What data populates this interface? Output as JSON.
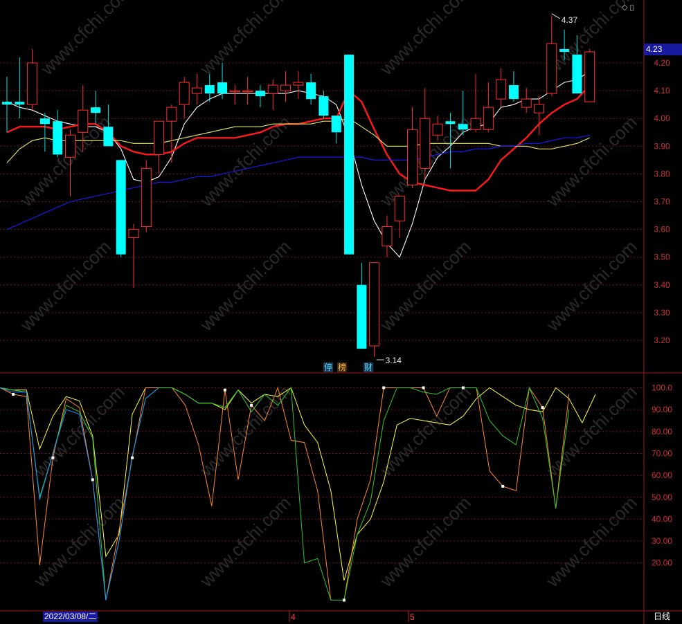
{
  "chart_data": [
    {
      "type": "candlestick",
      "title": "",
      "y_axis_labels": [
        "4.20",
        "4.10",
        "4.00",
        "3.90",
        "3.80",
        "3.70",
        "3.60",
        "3.50",
        "3.40",
        "3.30",
        "3.20"
      ],
      "ylim": [
        3.12,
        4.4
      ],
      "current_price": "4.23",
      "high_marker": "4.37",
      "low_marker": "3.14",
      "candles": [
        {
          "o": 4.06,
          "h": 4.15,
          "l": 3.95,
          "c": 4.05
        },
        {
          "o": 4.06,
          "h": 4.22,
          "l": 4.0,
          "c": 4.05
        },
        {
          "o": 4.05,
          "h": 4.25,
          "l": 4.03,
          "c": 4.2
        },
        {
          "o": 4.0,
          "h": 4.02,
          "l": 3.88,
          "c": 3.98
        },
        {
          "o": 3.99,
          "h": 4.03,
          "l": 3.86,
          "c": 3.87
        },
        {
          "o": 3.86,
          "h": 3.96,
          "l": 3.72,
          "c": 3.94
        },
        {
          "o": 3.95,
          "h": 4.12,
          "l": 3.88,
          "c": 4.03
        },
        {
          "o": 4.04,
          "h": 4.1,
          "l": 3.98,
          "c": 4.02
        },
        {
          "o": 3.97,
          "h": 4.05,
          "l": 3.9,
          "c": 3.9
        },
        {
          "o": 3.85,
          "h": 3.85,
          "l": 3.5,
          "c": 3.51
        },
        {
          "o": 3.57,
          "h": 3.62,
          "l": 3.39,
          "c": 3.6
        },
        {
          "o": 3.61,
          "h": 3.85,
          "l": 3.59,
          "c": 3.82
        },
        {
          "o": 3.87,
          "h": 3.99,
          "l": 3.8,
          "c": 3.99
        },
        {
          "o": 3.99,
          "h": 4.05,
          "l": 3.84,
          "c": 4.04
        },
        {
          "o": 4.05,
          "h": 4.15,
          "l": 4.0,
          "c": 4.13
        },
        {
          "o": 4.09,
          "h": 4.16,
          "l": 4.05,
          "c": 4.11
        },
        {
          "o": 4.12,
          "h": 4.16,
          "l": 4.06,
          "c": 4.09
        },
        {
          "o": 4.13,
          "h": 4.2,
          "l": 4.07,
          "c": 4.09
        },
        {
          "o": 4.1,
          "h": 4.12,
          "l": 4.05,
          "c": 4.1
        },
        {
          "o": 4.1,
          "h": 4.15,
          "l": 4.05,
          "c": 4.1
        },
        {
          "o": 4.1,
          "h": 4.12,
          "l": 4.04,
          "c": 4.08
        },
        {
          "o": 4.09,
          "h": 4.14,
          "l": 4.03,
          "c": 4.12
        },
        {
          "o": 4.1,
          "h": 4.17,
          "l": 4.06,
          "c": 4.12
        },
        {
          "o": 4.12,
          "h": 4.17,
          "l": 4.07,
          "c": 4.13
        },
        {
          "o": 4.13,
          "h": 4.16,
          "l": 4.05,
          "c": 4.07
        },
        {
          "o": 4.08,
          "h": 4.1,
          "l": 4.0,
          "c": 4.01
        },
        {
          "o": 4.01,
          "h": 4.0,
          "l": 3.91,
          "c": 3.95
        },
        {
          "o": 4.23,
          "h": 4.23,
          "l": 3.51,
          "c": 3.51
        },
        {
          "o": 3.4,
          "h": 3.48,
          "l": 3.17,
          "c": 3.17
        },
        {
          "o": 3.18,
          "h": 3.48,
          "l": 3.14,
          "c": 3.48
        },
        {
          "o": 3.54,
          "h": 3.65,
          "l": 3.5,
          "c": 3.61
        },
        {
          "o": 3.63,
          "h": 3.72,
          "l": 3.57,
          "c": 3.72
        },
        {
          "o": 3.76,
          "h": 4.04,
          "l": 3.75,
          "c": 3.96
        },
        {
          "o": 3.82,
          "h": 4.11,
          "l": 3.78,
          "c": 4.0
        },
        {
          "o": 3.94,
          "h": 4.01,
          "l": 3.92,
          "c": 3.98
        },
        {
          "o": 3.99,
          "h": 4.02,
          "l": 3.82,
          "c": 3.98
        },
        {
          "o": 3.98,
          "h": 4.1,
          "l": 3.94,
          "c": 3.96
        },
        {
          "o": 3.96,
          "h": 4.16,
          "l": 3.95,
          "c": 4.0
        },
        {
          "o": 3.96,
          "h": 4.13,
          "l": 3.95,
          "c": 4.04
        },
        {
          "o": 4.07,
          "h": 4.18,
          "l": 4.04,
          "c": 4.14
        },
        {
          "o": 4.12,
          "h": 4.17,
          "l": 4.06,
          "c": 4.07
        },
        {
          "o": 4.04,
          "h": 4.11,
          "l": 4.02,
          "c": 4.07
        },
        {
          "o": 4.02,
          "h": 4.08,
          "l": 3.94,
          "c": 4.05
        },
        {
          "o": 4.09,
          "h": 4.37,
          "l": 4.08,
          "c": 4.27
        },
        {
          "o": 4.25,
          "h": 4.32,
          "l": 4.21,
          "c": 4.24
        },
        {
          "o": 4.23,
          "h": 4.3,
          "l": 4.09,
          "c": 4.09
        },
        {
          "o": 4.06,
          "h": 4.25,
          "l": 4.06,
          "c": 4.24
        }
      ],
      "ma_lines": [
        {
          "name": "",
          "color": "#ffffff",
          "values": [
            4.06,
            4.04,
            4.03,
            4.01,
            3.99,
            3.98,
            3.97,
            3.97,
            3.95,
            3.89,
            3.78,
            3.77,
            3.79,
            3.86,
            3.98,
            4.04,
            4.07,
            4.09,
            4.09,
            4.09,
            4.09,
            4.09,
            4.09,
            4.1,
            4.09,
            4.08,
            4.05,
            3.93,
            3.76,
            3.63,
            3.55,
            3.5,
            3.62,
            3.78,
            3.86,
            3.9,
            3.95,
            3.97,
            3.98,
            4.04,
            4.05,
            4.07,
            4.07,
            4.1,
            4.13,
            4.14,
            4.17
          ]
        },
        {
          "name": "",
          "color": "#ff1a1a",
          "values": [
            3.95,
            3.97,
            3.97,
            3.97,
            3.96,
            3.97,
            3.98,
            3.98,
            3.95,
            3.9,
            3.88,
            3.87,
            3.87,
            3.88,
            3.91,
            3.93,
            3.93,
            3.93,
            3.93,
            3.94,
            3.95,
            3.97,
            3.98,
            3.98,
            3.99,
            4.0,
            4.0,
            4.1,
            4.06,
            3.96,
            3.87,
            3.8,
            3.77,
            3.76,
            3.75,
            3.74,
            3.74,
            3.74,
            3.78,
            3.85,
            3.89,
            3.93,
            3.98,
            4.02,
            4.05,
            4.07,
            4.12
          ]
        },
        {
          "name": "",
          "color": "#e8e86a",
          "values": [
            3.84,
            3.89,
            3.92,
            3.93,
            3.92,
            3.92,
            3.92,
            3.92,
            3.92,
            3.92,
            3.91,
            3.91,
            3.91,
            3.92,
            3.93,
            3.94,
            3.95,
            3.96,
            3.97,
            3.97,
            3.97,
            3.98,
            3.98,
            3.98,
            3.98,
            3.99,
            3.99,
            4.0,
            3.97,
            3.94,
            3.9,
            3.9,
            3.9,
            3.91,
            3.91,
            3.91,
            3.91,
            3.91,
            3.91,
            3.9,
            3.9,
            3.9,
            3.89,
            3.89,
            3.9,
            3.91,
            3.93
          ]
        },
        {
          "name": "",
          "color": "#1a1aff",
          "values": [
            3.6,
            3.62,
            3.64,
            3.66,
            3.68,
            3.7,
            3.71,
            3.72,
            3.73,
            3.74,
            3.75,
            3.76,
            3.77,
            3.77,
            3.78,
            3.79,
            3.79,
            3.8,
            3.81,
            3.82,
            3.83,
            3.84,
            3.85,
            3.86,
            3.86,
            3.86,
            3.86,
            3.86,
            3.86,
            3.85,
            3.85,
            3.85,
            3.85,
            3.86,
            3.87,
            3.88,
            3.88,
            3.89,
            3.89,
            3.9,
            3.9,
            3.91,
            3.91,
            3.92,
            3.93,
            3.93,
            3.94
          ]
        }
      ],
      "event_tags": [
        "停",
        "榜",
        "财"
      ]
    },
    {
      "type": "line",
      "title": "",
      "y_axis_labels": [
        "100.0",
        "90.00",
        "80.00",
        "70.00",
        "60.00",
        "50.00",
        "40.00",
        "30.00",
        "20.00"
      ],
      "ylim": [
        0,
        105
      ],
      "series": [
        {
          "name": "",
          "color": "#ffff40",
          "values": [
            100,
            99,
            99,
            72,
            87,
            96,
            94,
            78,
            23,
            33,
            88,
            100,
            100,
            100,
            97,
            93,
            93,
            90,
            99,
            93,
            97,
            96,
            100,
            83,
            75,
            53,
            12,
            33,
            40,
            57,
            83,
            86,
            85,
            84,
            83,
            87,
            95,
            100,
            96,
            92,
            90,
            89,
            100,
            95,
            84,
            97
          ]
        },
        {
          "name": "",
          "color": "#ff8a30",
          "values": [
            100,
            97,
            96,
            19,
            68,
            95,
            91,
            58,
            3,
            35,
            68,
            100,
            100,
            100,
            92,
            74,
            46,
            99,
            58,
            92,
            85,
            100,
            76,
            75,
            53,
            3,
            3,
            40,
            58,
            100,
            100,
            100,
            100,
            87,
            100,
            100,
            100,
            62,
            55,
            53,
            100,
            91,
            45,
            97
          ]
        },
        {
          "name": "",
          "color": "#2ecc2e",
          "values": [
            100,
            99,
            98,
            50,
            70,
            92,
            89,
            77,
            3,
            30,
            69,
            95,
            100,
            100,
            97,
            93,
            93,
            91,
            99,
            89,
            97,
            92,
            100,
            20,
            22,
            3,
            3,
            33,
            48,
            85,
            100,
            100,
            98,
            97,
            100,
            100,
            100,
            85,
            78,
            74,
            100,
            86,
            45,
            90
          ]
        },
        {
          "name": "",
          "color": "#1e90ff",
          "values": [
            100,
            98,
            98,
            49,
            70,
            90,
            88,
            58,
            3,
            30,
            69,
            95,
            100
          ]
        }
      ],
      "x_labels": [
        "2022/03/08/二",
        "4",
        "5",
        "日线"
      ]
    }
  ]
}
